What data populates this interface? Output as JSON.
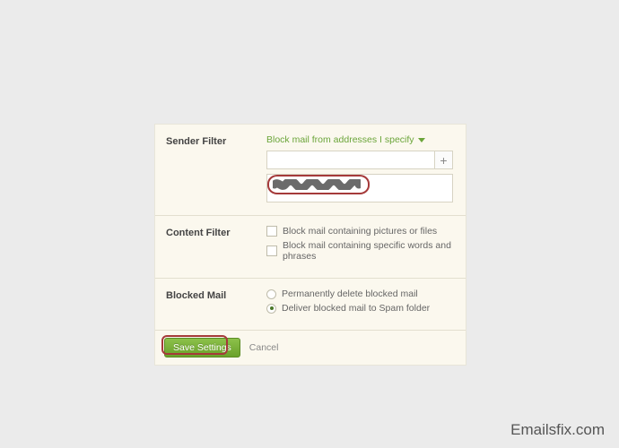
{
  "sender_filter": {
    "label": "Sender Filter",
    "dropdown_text": "Block mail from addresses I specify",
    "address_input": "",
    "add_icon": "+"
  },
  "content_filter": {
    "label": "Content Filter",
    "options": [
      {
        "label": "Block mail containing pictures or files",
        "checked": false
      },
      {
        "label": "Block mail containing specific words and phrases",
        "checked": false
      }
    ]
  },
  "blocked_mail": {
    "label": "Blocked Mail",
    "options": [
      {
        "label": "Permanently delete blocked mail",
        "selected": false
      },
      {
        "label": "Deliver blocked mail to Spam folder",
        "selected": true
      }
    ]
  },
  "footer": {
    "save_label": "Save Settings",
    "cancel_label": "Cancel"
  },
  "watermark": "Emailsfix.com"
}
